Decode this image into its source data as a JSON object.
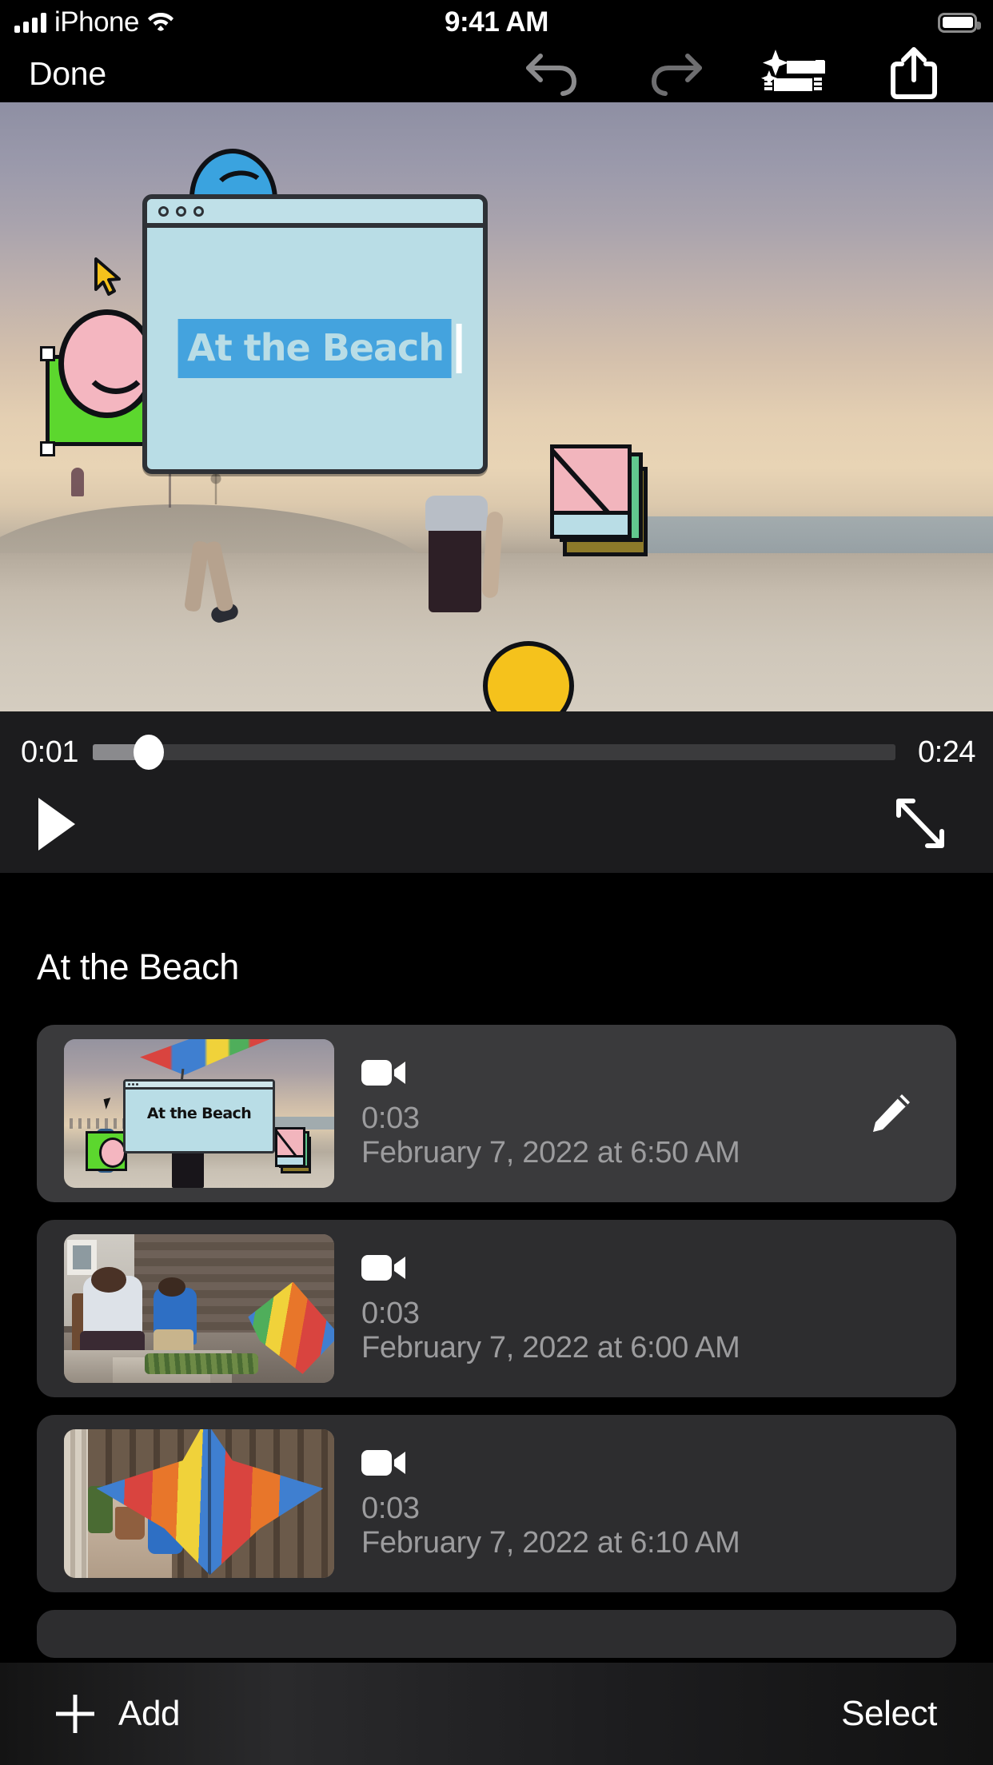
{
  "status_bar": {
    "carrier": "iPhone",
    "time": "9:41 AM",
    "signal_icon": "cellular-bars-icon",
    "wifi_icon": "wifi-icon",
    "battery_icon": "battery-full-icon"
  },
  "navbar": {
    "done_label": "Done",
    "undo_icon": "undo-arrow-icon",
    "redo_icon": "redo-arrow-icon",
    "magic_movie_icon": "magic-movie-icon",
    "share_icon": "share-up-arrow-icon"
  },
  "preview": {
    "overlay_title": "At the Beach",
    "cursor_icon": "pointer-cursor-sticker",
    "selection_handles": 3,
    "colors": {
      "window_fill": "#b9dde6",
      "window_border": "#2e3136",
      "highlight": "#44a3de",
      "green_card": "#5cd72e",
      "face_pink": "#f4b6c0",
      "ball_blue": "#3aa3df",
      "ball_yellow": "#f5c21c",
      "photo_pink": "#f2b5bd"
    }
  },
  "scrubber": {
    "current_time": "0:01",
    "total_time": "0:24",
    "progress_percent": 7,
    "play_icon": "play-triangle-icon",
    "expand_icon": "expand-fullscreen-icon"
  },
  "project": {
    "title": "At the Beach"
  },
  "clips": [
    {
      "media_icon": "video-camera-icon",
      "duration": "0:03",
      "date": "February 7, 2022 at 6:50 AM",
      "selected": true,
      "edit_icon": "pencil-edit-icon",
      "thumbnail_title": "At the Beach"
    },
    {
      "media_icon": "video-camera-icon",
      "duration": "0:03",
      "date": "February 7, 2022 at 6:00 AM",
      "selected": false
    },
    {
      "media_icon": "video-camera-icon",
      "duration": "0:03",
      "date": "February 7, 2022 at 6:10 AM",
      "selected": false
    }
  ],
  "bottom_bar": {
    "add_label": "Add",
    "add_icon": "plus-icon",
    "select_label": "Select"
  }
}
